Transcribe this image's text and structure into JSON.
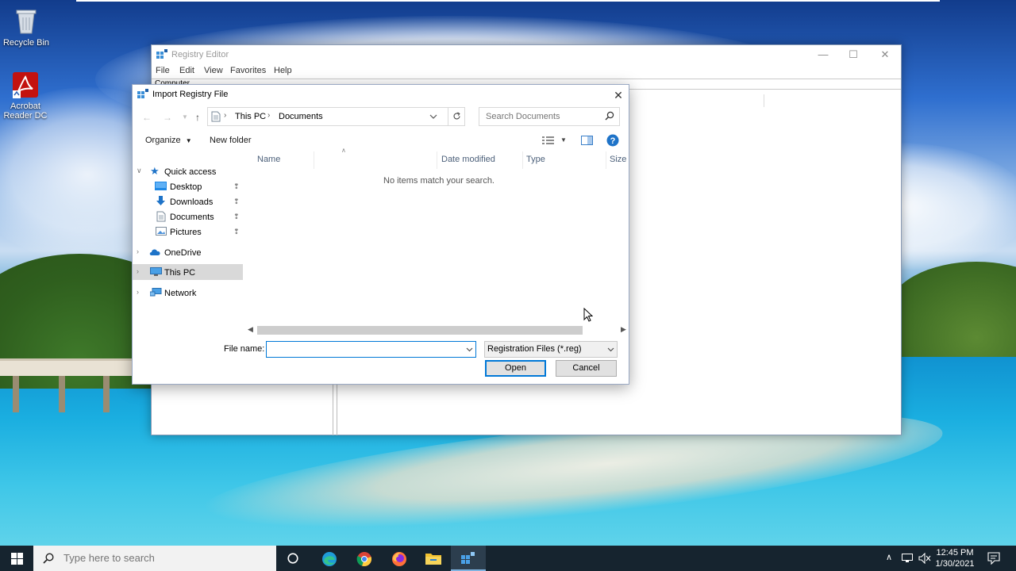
{
  "desktop": {
    "icons": [
      {
        "label": "Recycle Bin",
        "icon": "recycle-bin-icon"
      },
      {
        "label": "Acrobat Reader DC",
        "icon": "acrobat-icon"
      }
    ]
  },
  "regedit": {
    "title": "Registry Editor",
    "menu": [
      "File",
      "Edit",
      "View",
      "Favorites",
      "Help"
    ],
    "address": "Computer"
  },
  "dialog": {
    "title": "Import Registry File",
    "breadcrumb": [
      "This PC",
      "Documents"
    ],
    "search_placeholder": "Search Documents",
    "toolbar": {
      "organize": "Organize",
      "new_folder": "New folder"
    },
    "tree": {
      "quick_access": "Quick access",
      "pinned": [
        "Desktop",
        "Downloads",
        "Documents",
        "Pictures"
      ],
      "onedrive": "OneDrive",
      "this_pc": "This PC",
      "network": "Network"
    },
    "columns": [
      "Name",
      "Date modified",
      "Type",
      "Size"
    ],
    "empty_message": "No items match your search.",
    "file_name_label": "File name:",
    "file_name_value": "",
    "file_type": "Registration Files (*.reg)",
    "open_label": "Open",
    "cancel_label": "Cancel"
  },
  "taskbar": {
    "search_placeholder": "Type here to search",
    "apps": [
      "cortana-icon",
      "edge-icon",
      "chrome-icon",
      "firefox-icon",
      "file-explorer-icon",
      "regedit-icon"
    ],
    "time": "12:45 PM",
    "date": "1/30/2021"
  },
  "colors": {
    "accent": "#0078d7",
    "taskbar": "#16242f",
    "selection": "#d9d9d9"
  }
}
